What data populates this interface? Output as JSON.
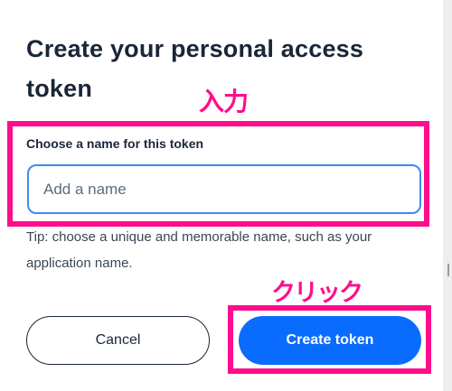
{
  "dialog": {
    "title": "Create your personal access token",
    "field_label": "Choose a name for this token",
    "name_placeholder": "Add a name",
    "name_value": "",
    "tip": "Tip: choose a unique and memorable name, such as your application name.",
    "cancel_label": "Cancel",
    "create_label": "Create token"
  },
  "annotations": {
    "input_note": "入力",
    "click_note": "クリック",
    "highlight_color": "#ff0d8c"
  },
  "colors": {
    "primary": "#0a6cff",
    "input_focus_border": "#3b8cf0",
    "text_dark": "#1a2638"
  }
}
